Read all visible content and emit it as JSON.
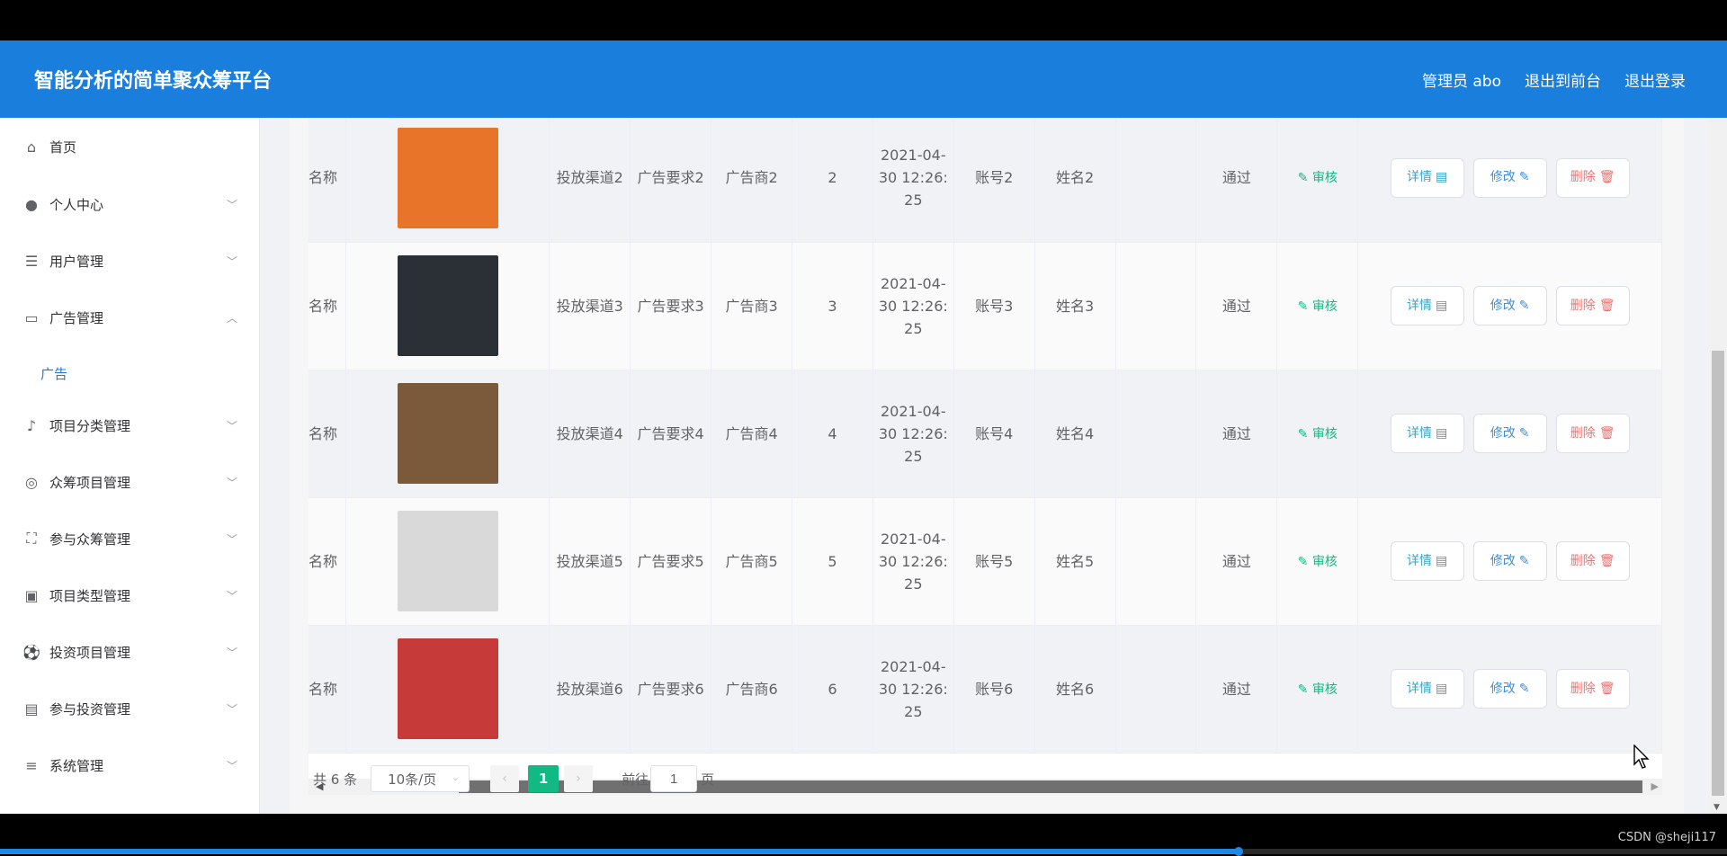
{
  "header": {
    "title": "智能分析的简单聚众筹平台",
    "admin_label": "管理员 abo",
    "to_frontend": "退出到前台",
    "logout": "退出登录"
  },
  "sidebar": {
    "items": [
      {
        "label": "首页",
        "icon": "home-icon"
      },
      {
        "label": "个人中心",
        "icon": "user-icon"
      },
      {
        "label": "用户管理",
        "icon": "sliders-icon"
      },
      {
        "label": "广告管理",
        "icon": "message-icon"
      },
      {
        "label": "项目分类管理",
        "icon": "bell-off-icon"
      },
      {
        "label": "众筹项目管理",
        "icon": "compass-icon"
      },
      {
        "label": "参与众筹管理",
        "icon": "full-screen-icon"
      },
      {
        "label": "项目类型管理",
        "icon": "clipboard-icon"
      },
      {
        "label": "投资项目管理",
        "icon": "soccer-icon"
      },
      {
        "label": "参与投资管理",
        "icon": "wallet-icon"
      },
      {
        "label": "系统管理",
        "icon": "list-icon"
      }
    ],
    "sub_item": "广告"
  },
  "table": {
    "rows": [
      {
        "name": "名称",
        "channel": "投放渠道2",
        "requirement": "广告要求2",
        "advertiser": "广告商2",
        "num": "2",
        "date": "2021-04-30 12:26:25",
        "account": "账号2",
        "person": "姓名2",
        "status": "通过",
        "audit": "审核",
        "img_color": "#e8742a"
      },
      {
        "name": "名称",
        "channel": "投放渠道3",
        "requirement": "广告要求3",
        "advertiser": "广告商3",
        "num": "3",
        "date": "2021-04-30 12:26:25",
        "account": "账号3",
        "person": "姓名3",
        "status": "通过",
        "audit": "审核",
        "img_color": "#2b2f36"
      },
      {
        "name": "名称",
        "channel": "投放渠道4",
        "requirement": "广告要求4",
        "advertiser": "广告商4",
        "num": "4",
        "date": "2021-04-30 12:26:25",
        "account": "账号4",
        "person": "姓名4",
        "status": "通过",
        "audit": "审核",
        "img_color": "#7a5a3a"
      },
      {
        "name": "名称",
        "channel": "投放渠道5",
        "requirement": "广告要求5",
        "advertiser": "广告商5",
        "num": "5",
        "date": "2021-04-30 12:26:25",
        "account": "账号5",
        "person": "姓名5",
        "status": "通过",
        "audit": "审核",
        "img_color": "#d9d9d9"
      },
      {
        "name": "名称",
        "channel": "投放渠道6",
        "requirement": "广告要求6",
        "advertiser": "广告商6",
        "num": "6",
        "date": "2021-04-30 12:26:25",
        "account": "账号6",
        "person": "姓名6",
        "status": "通过",
        "audit": "审核",
        "img_color": "#c73a3a"
      }
    ],
    "actions": {
      "detail": "详情",
      "edit": "修改",
      "delete": "删除"
    }
  },
  "pagination": {
    "total": "共 6 条",
    "page_size": "10条/页",
    "current_page": "1",
    "goto_label": "前往",
    "goto_value": "1",
    "page_unit": "页"
  },
  "watermark": "CSDN @sheji117",
  "video_progress": 0.717
}
